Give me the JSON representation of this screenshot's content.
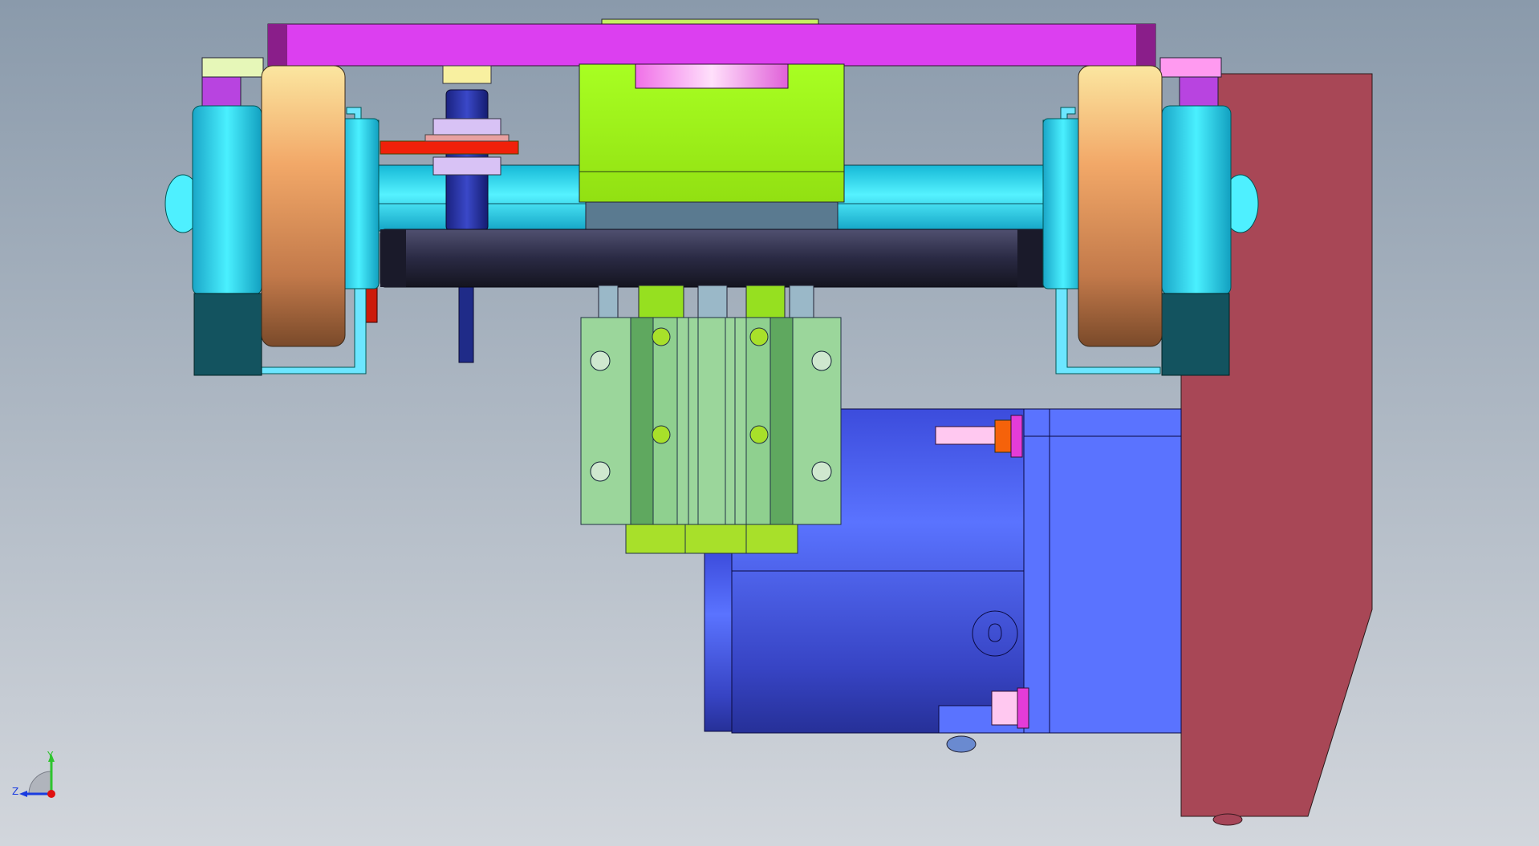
{
  "viewport": {
    "background_top": "#8a9aab",
    "background_bottom": "#d2d6dc"
  },
  "triad": {
    "y_label": "Y",
    "z_label": "Z",
    "y_color": "#2ec42e",
    "x_color": "#e01010",
    "z_color": "#1a3ce0"
  },
  "colors": {
    "top_bar": "#dc3ff0",
    "top_bar_end": "#8a1e8a",
    "green_block": "#a3f51e",
    "shaft": "#2ee1ff",
    "dark_rod": "#262640",
    "wheel": "#f2a868",
    "hub": "#22ccee",
    "hub_dark": "#13535f",
    "guide_block": "#9bd69b",
    "guide_dark": "#5fa85f",
    "motor": "#4a5ef0",
    "motor_light": "#5a73ff",
    "motor_dark": "#2630a8",
    "plate": "#a84756",
    "sensor_dark": "#1f2b88",
    "sensor_nut": "#d8c2f5",
    "sensor_bracket": "#f0200a",
    "orange_part": "#f5620a",
    "magenta_part": "#e43cd8"
  }
}
